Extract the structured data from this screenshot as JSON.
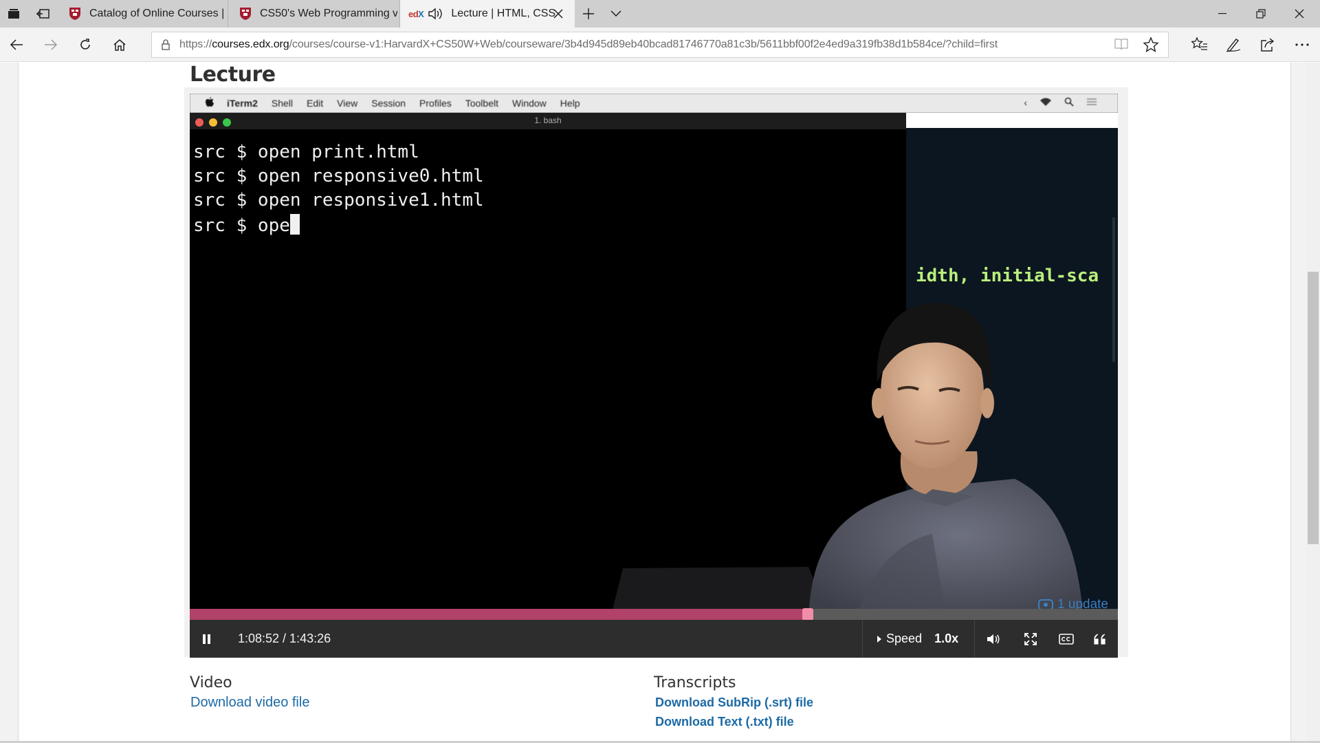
{
  "browser": {
    "tabs": [
      {
        "title": "Catalog of Online Courses |",
        "icon": "harvard-shield-icon"
      },
      {
        "title": "CS50's Web Programming v",
        "icon": "harvard-shield-icon"
      },
      {
        "title": "Lecture | HTML, CSS",
        "icon": "edx-logo-icon",
        "active": true,
        "audio": true
      }
    ],
    "edx_logo": {
      "e": "ed",
      "x": "X"
    },
    "url_prefix": "https://",
    "url_host": "courses.edx.org",
    "url_path": "/courses/course-v1:HarvardX+CS50W+Web/courseware/3b4d945d89eb40bcad81746770a81c3b/5611bbf00f2e4ed9a319fb38d1b584ce/?child=first",
    "colors": {
      "tabbar": "#cfcfcf",
      "navbar": "#f3f3f3",
      "progress": "#b1426a",
      "controls": "#2d2d2d",
      "link": "#1c6aa5"
    }
  },
  "page": {
    "section_title": "Lecture"
  },
  "video": {
    "mac_menu": [
      "iTerm2",
      "Shell",
      "Edit",
      "View",
      "Session",
      "Profiles",
      "Toolbelt",
      "Window",
      "Help"
    ],
    "terminal_title": "1. bash",
    "terminal_lines": [
      "src $ open print.html",
      "src $ open responsive0.html",
      "src $ open responsive1.html",
      "src $ ope"
    ],
    "editor_text": "idth, initial-sca",
    "update_badge": "1 update",
    "elapsed": "1:08:52",
    "duration": "1:43:26",
    "time_display": "1:08:52 / 1:43:26",
    "progress_fraction": 0.6658,
    "speed_label": "Speed",
    "speed_value": "1.0x"
  },
  "downloads": {
    "video_heading": "Video",
    "video_link": "Download video file",
    "transcripts_heading": "Transcripts",
    "srt_link": "Download SubRip (.srt) file",
    "txt_link": "Download Text (.txt) file"
  }
}
